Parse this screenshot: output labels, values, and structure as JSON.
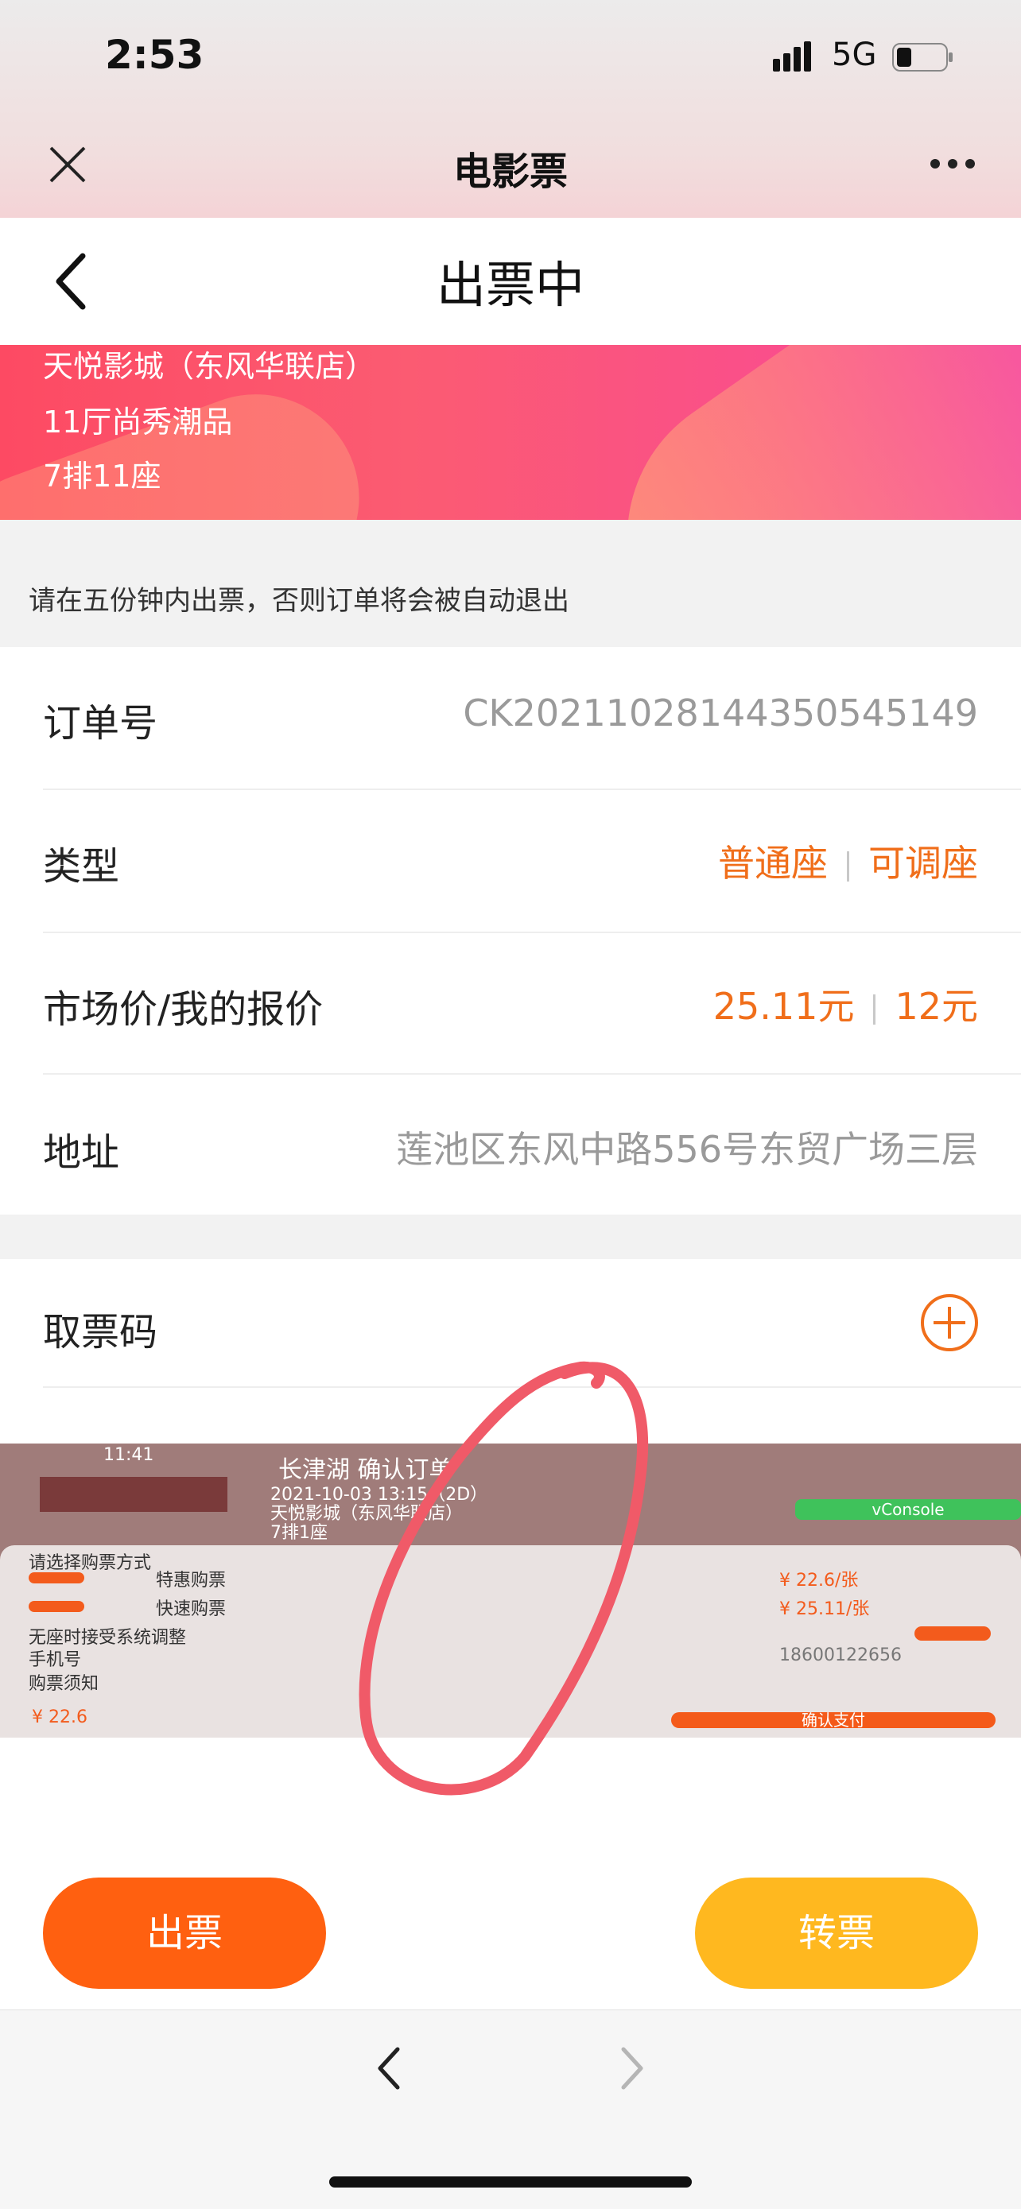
{
  "status_bar": {
    "time": "2:53",
    "network": "5G"
  },
  "nav": {
    "title": "电影票"
  },
  "page": {
    "title": "出票中"
  },
  "banner": {
    "cinema": "天悦影城（东风华联店）",
    "hall": "11厅尚秀潮品",
    "seat": "7排11座"
  },
  "notice": "请在五份钟内出票，否则订单将会被自动退出",
  "order": {
    "order_no_label": "订单号",
    "order_no_value": "CK20211028144350545149",
    "type_label": "类型",
    "type_value_1": "普通座",
    "type_value_2": "可调座",
    "price_label": "市场价/我的报价",
    "market_price": "25.11元",
    "my_price": "12元",
    "address_label": "地址",
    "address_value": "莲池区东风中路556号东贸广场三层"
  },
  "ticket_code": {
    "label": "取票码"
  },
  "embedded_screenshot": {
    "time": "11:41",
    "header": "长津湖 确认订单",
    "movie_lines": [
      "2021-10-03 13:15（2D）",
      "天悦影城（东风华联店）",
      "7排1座"
    ],
    "console_label": "vConsole",
    "select_method": "请选择购票方式",
    "option_1": "特惠购票",
    "option_1_price": "¥ 22.6/张",
    "option_2": "快速购票",
    "option_2_price": "¥ 25.11/张",
    "no_seat_adjust": "无座时接受系统调整",
    "phone_label": "手机号",
    "phone_value": "18600122656",
    "notice_title": "购票须知",
    "total": "¥ 22.6",
    "confirm_pay": "确认支付"
  },
  "actions": {
    "issue": "出票",
    "transfer": "转票"
  },
  "colors": {
    "accent_orange": "#ff6010",
    "accent_yellow": "#ffb81f",
    "banner_pink": "#fb5b72"
  }
}
